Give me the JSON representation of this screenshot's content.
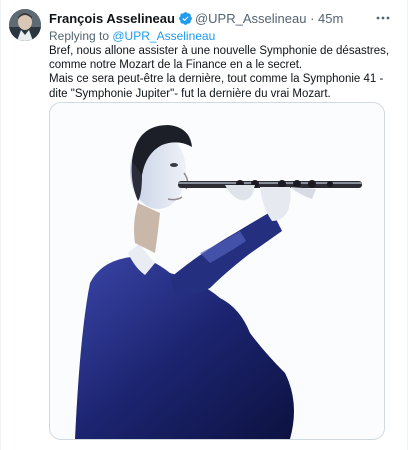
{
  "tweet": {
    "author_name": "François Asselineau",
    "author_handle": "@UPR_Asselineau",
    "separator": "·",
    "time": "45m",
    "reply_prefix": "Replying to ",
    "reply_handle": "@UPR_Asselineau",
    "text_lines": [
      "Bref, nous allone assister à une nouvelle Symphonie de désastres, comme notre Mozart de la Finance en a le secret.",
      "Mais ce sera peut-être la dernière, tout comme la Symphonie 41 -dite \"Symphonie Jupiter\"- fut la dernière du vrai Mozart."
    ]
  },
  "icons": {
    "verified": "verified-badge-icon",
    "more": "more-options-icon"
  },
  "colors": {
    "accent": "#1d9bf0",
    "secondary_text": "#536471",
    "primary_text": "#0f1419"
  }
}
